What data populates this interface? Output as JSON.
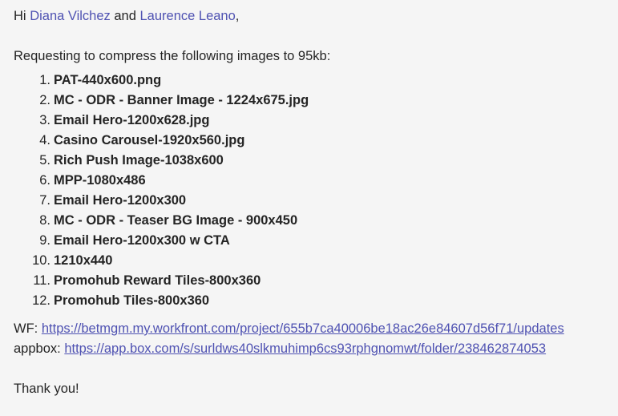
{
  "greeting": {
    "hi": "Hi",
    "mention_1": "Diana Vilchez",
    "and": "and",
    "mention_2": "Laurence Leano",
    "comma": ","
  },
  "request_text": "Requesting to compress the following images to 95kb:",
  "files": [
    {
      "num": "1.",
      "name": "PAT-440x600.png"
    },
    {
      "num": "2.",
      "name": "MC - ODR - Banner Image - 1224x675.jpg"
    },
    {
      "num": "3.",
      "name": "Email Hero-1200x628.jpg"
    },
    {
      "num": "4.",
      "name": "Casino Carousel-1920x560.jpg"
    },
    {
      "num": "5.",
      "name": "Rich Push Image-1038x600"
    },
    {
      "num": "6.",
      "name": "MPP-1080x486"
    },
    {
      "num": "7.",
      "name": "Email Hero-1200x300"
    },
    {
      "num": "8.",
      "name": "MC - ODR - Teaser BG Image - 900x450"
    },
    {
      "num": "9.",
      "name": "Email Hero-1200x300 w CTA"
    },
    {
      "num": "10.",
      "name": "1210x440"
    },
    {
      "num": "11.",
      "name": "Promohub Reward Tiles-800x360"
    },
    {
      "num": "12.",
      "name": "Promohub Tiles-800x360"
    }
  ],
  "links": {
    "wf_label": "WF:",
    "wf_url": "https://betmgm.my.workfront.com/project/655b7ca40006be18ac26e84607d56f71/updates",
    "appbox_label": "appbox:",
    "appbox_url": "https://app.box.com/s/surldws40slkmuhimp6cs93rphgnomwt/folder/238462874053"
  },
  "closing": "Thank you!",
  "colors": {
    "mention": "#4f52b2",
    "link": "#4f52b2",
    "text": "#242424",
    "background": "#f5f5f5"
  }
}
